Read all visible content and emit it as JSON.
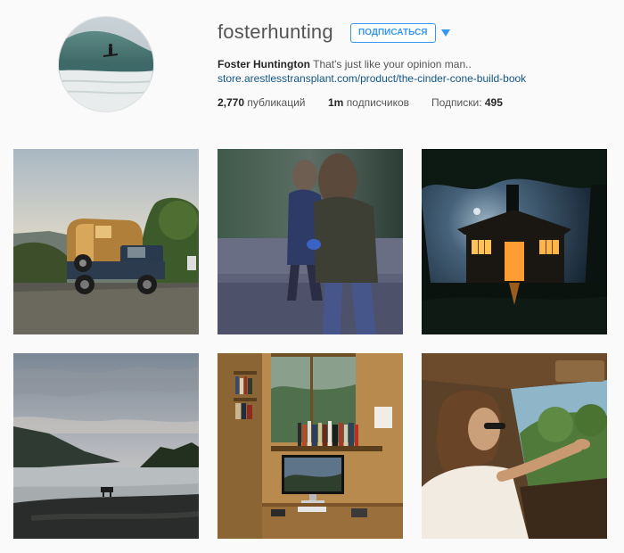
{
  "profile": {
    "username": "fosterhunting",
    "follow_label": "ПОДПИСАТЬСЯ",
    "full_name": "Foster Huntington",
    "bio": "That's just like your opinion man..",
    "link": "store.arestlesstransplant.com/product/the-cinder-cone-build-book",
    "stats": {
      "posts_count": "2,770",
      "posts_label": "публикаций",
      "followers_count": "1m",
      "followers_label": "подписчиков",
      "following_label": "Подписки:",
      "following_count": "495"
    }
  },
  "colors": {
    "accent": "#3897f0",
    "link": "#125688",
    "background": "#fafafa"
  },
  "grid": {
    "photos": [
      {
        "subject": "camper-truck-sunset"
      },
      {
        "subject": "people-walking-blur"
      },
      {
        "subject": "treehouse-night"
      },
      {
        "subject": "river-bank-dog"
      },
      {
        "subject": "cabin-desk-computer"
      },
      {
        "subject": "woman-driving-car"
      }
    ]
  }
}
